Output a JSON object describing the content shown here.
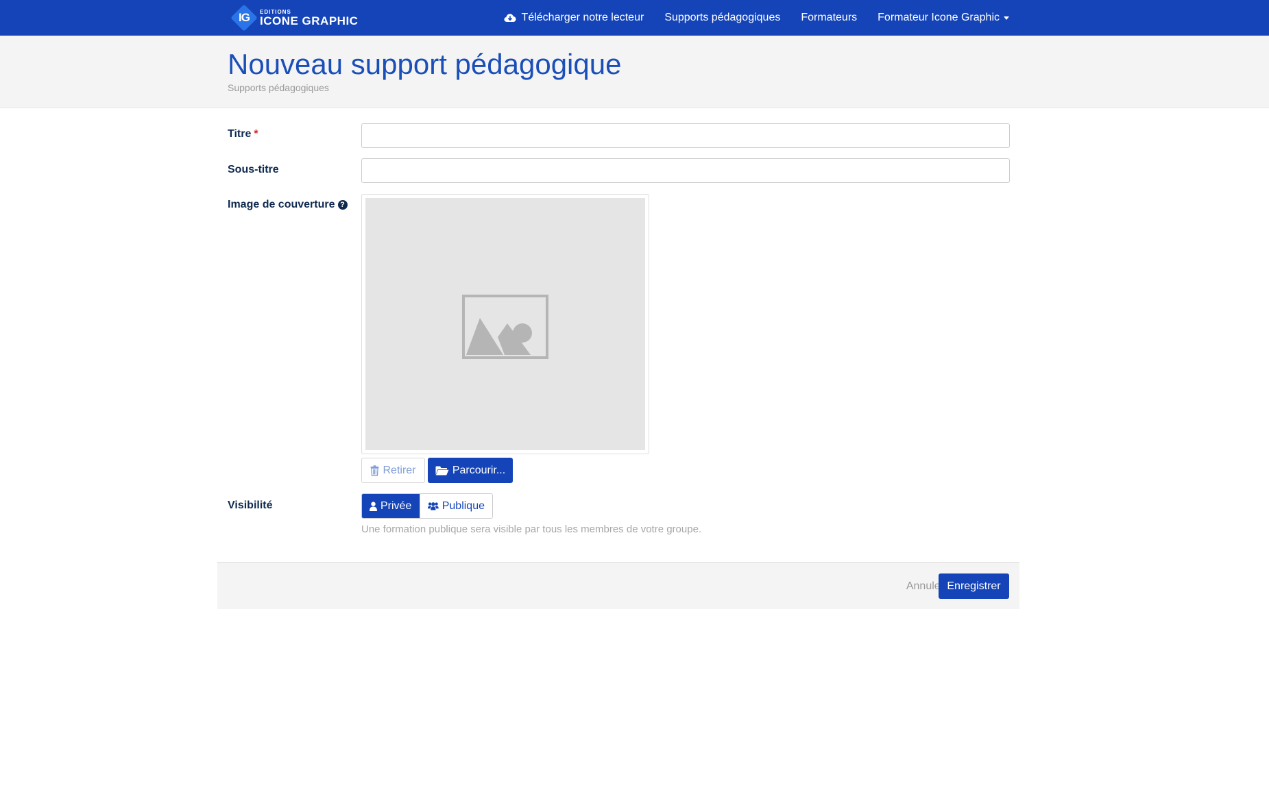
{
  "navbar": {
    "brand": {
      "logo_letters": "IG",
      "small": "EDITIONS",
      "big": "ICONE GRAPHIC"
    },
    "items": [
      {
        "label": "Télécharger notre lecteur",
        "icon": "cloud-download-icon"
      },
      {
        "label": "Supports pédagogiques"
      },
      {
        "label": "Formateurs"
      },
      {
        "label": "Formateur Icone Graphic",
        "icon": "caret-down-icon"
      }
    ]
  },
  "header": {
    "title": "Nouveau support pédagogique",
    "breadcrumb": "Supports pédagogiques"
  },
  "form": {
    "titre": {
      "label": "Titre",
      "required_mark": "*",
      "value": "",
      "placeholder": ""
    },
    "sous_titre": {
      "label": "Sous-titre",
      "value": "",
      "placeholder": ""
    },
    "image": {
      "label": "Image de couverture",
      "help_icon": "question-circle-icon",
      "help_glyph": "?",
      "remove_label": "Retirer",
      "browse_label": "Parcourir..."
    },
    "visibilite": {
      "label": "Visibilité",
      "options": [
        {
          "label": "Privée",
          "icon": "user-icon",
          "selected": true
        },
        {
          "label": "Publique",
          "icon": "users-icon",
          "selected": false
        }
      ],
      "help_text": "Une formation publique sera visible par tous les membres de votre groupe."
    }
  },
  "footer": {
    "cancel_label": "Annuler",
    "save_label": "Enregistrer"
  },
  "colors": {
    "primary": "#1444b8",
    "title": "#1b4fb8",
    "required": "#d9242a",
    "muted": "#a6a6a6"
  }
}
